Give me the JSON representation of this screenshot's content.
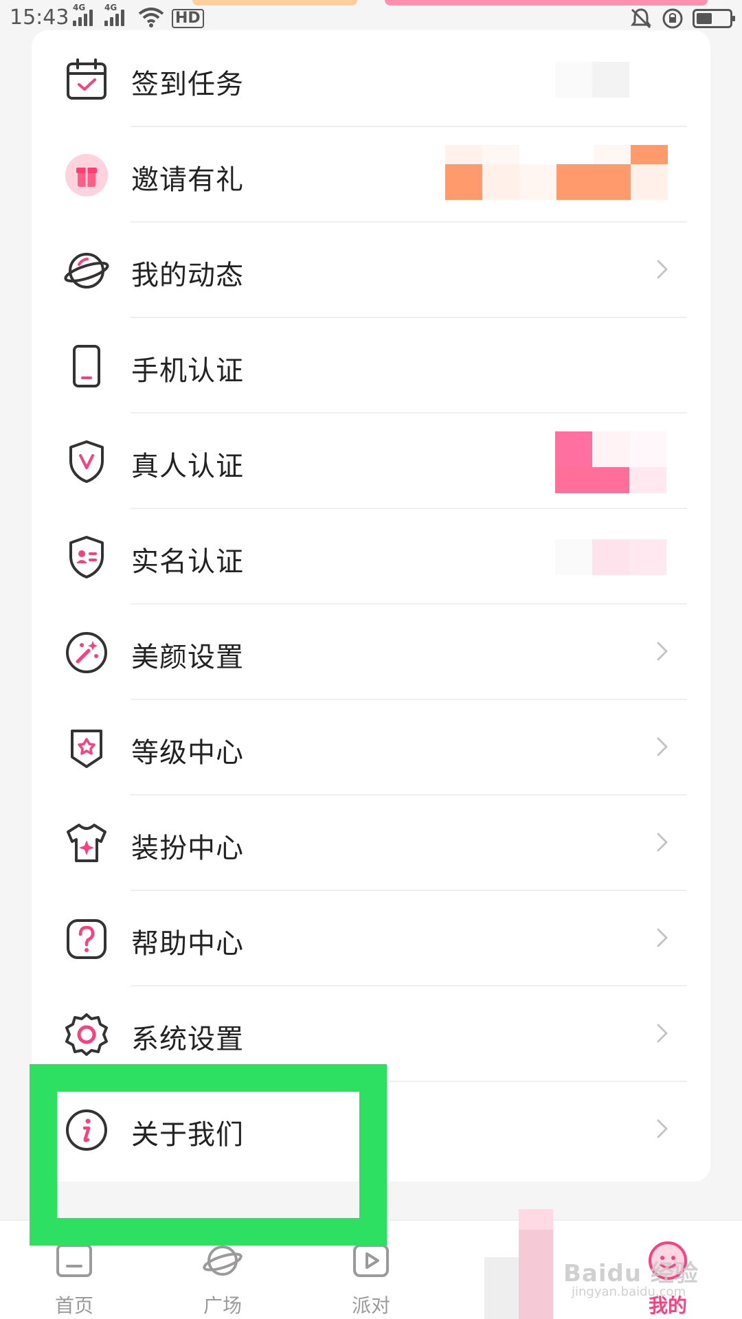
{
  "status_bar": {
    "time": "15:43",
    "network_1": "4G",
    "network_2": "4G",
    "hd_label": "HD",
    "icons": [
      "signal-icon",
      "signal-icon",
      "wifi-icon",
      "hd-icon",
      "mute-icon",
      "rotation-lock-icon",
      "battery-icon"
    ]
  },
  "menu": {
    "items": [
      {
        "label": "签到任务",
        "icon": "calendar-check-icon",
        "chevron": false
      },
      {
        "label": "邀请有礼",
        "icon": "gift-icon",
        "chevron": false
      },
      {
        "label": "我的动态",
        "icon": "planet-icon",
        "chevron": true
      },
      {
        "label": "手机认证",
        "icon": "phone-icon",
        "chevron": false
      },
      {
        "label": "真人认证",
        "icon": "shield-v-icon",
        "chevron": false
      },
      {
        "label": "实名认证",
        "icon": "shield-id-icon",
        "chevron": false
      },
      {
        "label": "美颜设置",
        "icon": "beauty-wand-icon",
        "chevron": true
      },
      {
        "label": "等级中心",
        "icon": "badge-flower-icon",
        "chevron": true
      },
      {
        "label": "装扮中心",
        "icon": "shirt-sparkle-icon",
        "chevron": true
      },
      {
        "label": "帮助中心",
        "icon": "help-question-icon",
        "chevron": true
      },
      {
        "label": "系统设置",
        "icon": "gear-icon",
        "chevron": true
      },
      {
        "label": "关于我们",
        "icon": "info-icon",
        "chevron": true
      }
    ]
  },
  "bottom_nav": {
    "items": [
      {
        "label": "首页",
        "icon": "home-icon",
        "active": false
      },
      {
        "label": "广场",
        "icon": "planet-icon",
        "active": false
      },
      {
        "label": "派对",
        "icon": "play-icon",
        "active": false
      },
      {
        "label": "我的",
        "icon": "smile-face-icon",
        "active": true
      }
    ]
  },
  "watermark": {
    "text": "Baidu 经验",
    "sub": "jingyan.baidu.com"
  },
  "colors": {
    "accent": "#ff3d7f",
    "icon_stroke": "#333333",
    "highlight": "#2ee062",
    "card_bg": "#ffffff",
    "page_bg": "#f5f5f5"
  }
}
